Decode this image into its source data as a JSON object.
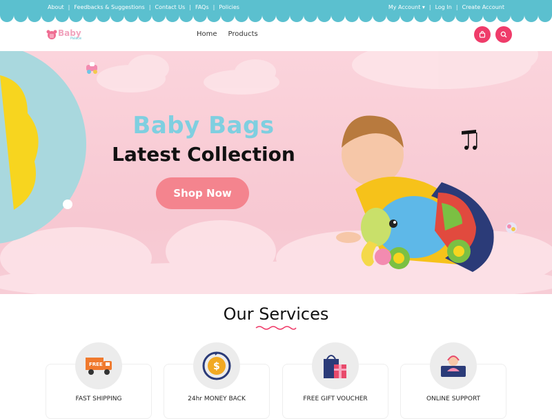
{
  "topbar": {
    "links": [
      "About",
      "Feedbacks & Suggestions",
      "Contact Us",
      "FAQs",
      "Policies"
    ],
    "account": "My Account",
    "login": "Log In",
    "create": "Create Account",
    "color": "#5bc0cf"
  },
  "header": {
    "logo_main": "Baby",
    "logo_sub": "Palace",
    "nav": [
      "Home",
      "Products"
    ],
    "cart_icon": "shopping-bag-icon",
    "search_icon": "search-icon",
    "button_color": "#ef3c6a"
  },
  "hero": {
    "title": "Baby Bags",
    "subtitle": "Latest Collection",
    "cta": "Shop Now",
    "bg_color": "#f7c8d2",
    "cta_color": "#f4848e"
  },
  "services": {
    "title": "Our Services",
    "items": [
      {
        "label": "FAST SHIPPING",
        "icon": "truck-icon",
        "badge": "FREE"
      },
      {
        "label": "24hr MONEY BACK",
        "icon": "money-back-icon"
      },
      {
        "label": "FREE GIFT VOUCHER",
        "icon": "gift-bag-icon"
      },
      {
        "label": "ONLINE SUPPORT",
        "icon": "support-agent-icon"
      }
    ]
  }
}
